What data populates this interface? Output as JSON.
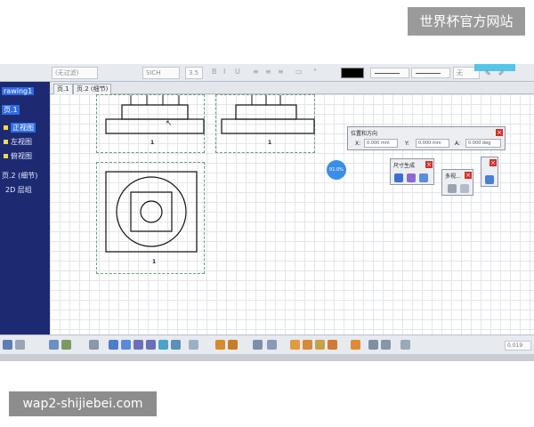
{
  "watermarks": {
    "top": "世界杯官方网站",
    "bottom": "wap2-shijiebei.com"
  },
  "toolbar": {
    "style_field": "(无过滤)",
    "font_field": "SICH",
    "size_field": "3.5",
    "color_name": "无"
  },
  "tree": {
    "items": [
      "rawing1",
      "页.1",
      "正视图",
      "左视图",
      "俯视图",
      "页.2 (细节)",
      "2D 层组"
    ]
  },
  "tabs": [
    "页.1",
    "页.2 (细节)"
  ],
  "views": {
    "label_1": "1",
    "label_2": "1",
    "label_3": "1"
  },
  "badge": "91.0%",
  "position_panel": {
    "title": "位置和方向",
    "x_label": "X:",
    "x_value": "0.000 mm",
    "y_label": "Y:",
    "y_value": "0.000 mm",
    "a_label": "A:",
    "a_value": "0.000 deg"
  },
  "dim_panel": {
    "title": "尺寸生成"
  },
  "multi_panel": {
    "title": "多视..."
  },
  "bottom_toolbar": {
    "zoom_field": "0.019"
  },
  "colors": {
    "tree_bg": "#1d2a72",
    "tree_sel": "#2f6be0",
    "close": "#d2322d",
    "frame": "#6e9b76"
  }
}
